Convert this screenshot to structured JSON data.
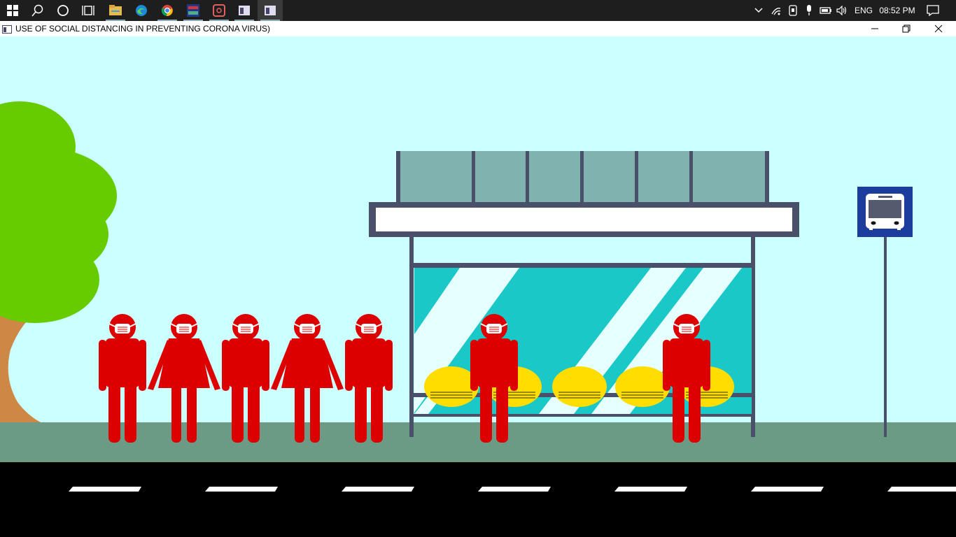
{
  "taskbar": {
    "icons": [
      "windows-start-icon",
      "search-icon",
      "cortana-icon",
      "task-view-icon",
      "file-explorer-icon",
      "edge-icon",
      "chrome-icon",
      "dev-app-icon",
      "pdf-app-icon",
      "app-window-icon",
      "running-app-icon"
    ],
    "tray": {
      "language": "ENG",
      "time": "08:52 PM"
    }
  },
  "window": {
    "title": "USE OF SOCIAL DISTANCING IN PREVENTING CORONA VIRUS)"
  },
  "scene": {
    "colors": {
      "sky": "#ccffff",
      "pavement": "#6b9a85",
      "road": "#000000",
      "lane_mark": "#ffffff",
      "tree_foliage": "#66cc00",
      "tree_trunk": "#cc8844",
      "shelter_frame": "#4a4f6a",
      "shelter_roof_glass": "#80b3b0",
      "shelter_panel": "#1bc8c8",
      "person": "#dd0000",
      "mask": "#ffffff",
      "seat": "#ffdd00",
      "bus_sign": "#1d3d9e"
    },
    "queue_people": [
      "man",
      "woman",
      "man",
      "woman",
      "man"
    ],
    "shelter_people": [
      "man",
      "man"
    ],
    "seat_count": 5,
    "lane_marks": 7
  }
}
